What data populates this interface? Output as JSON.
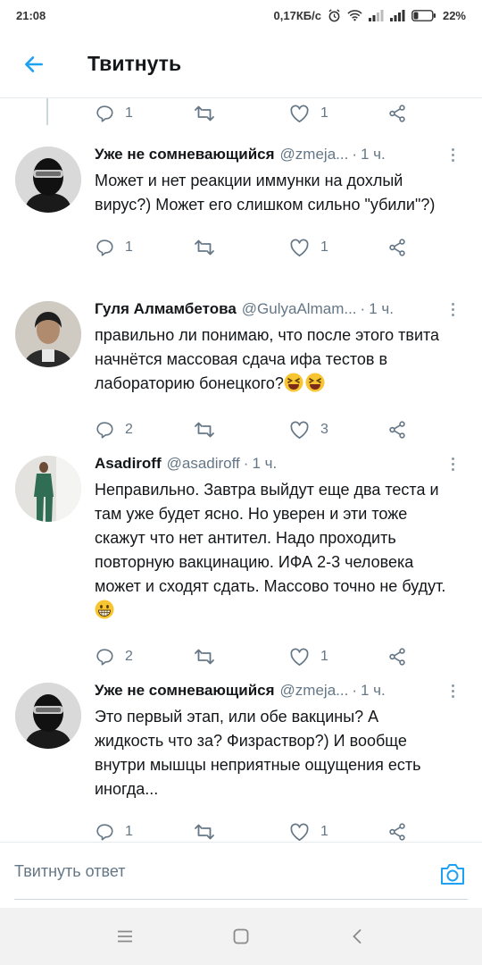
{
  "status_bar": {
    "time": "21:08",
    "network_speed": "0,17КБ/с",
    "battery": "22%",
    "icons": [
      "alarm-icon",
      "wifi-icon",
      "signal-icon",
      "signal-icon",
      "battery-icon"
    ]
  },
  "header": {
    "title": "Твитнуть",
    "back_icon": "arrow-left-icon"
  },
  "partial_tweet": {
    "replies": "1",
    "likes": "1"
  },
  "tweets": [
    {
      "name": "Уже не сомневающийся",
      "handle": "@zmeja...",
      "time": "1 ч.",
      "text": "Может и нет реакции иммунки на дохлый вирус?) Может его слишком сильно \"убили\"?)",
      "replies": "1",
      "likes": "1"
    },
    {
      "name": "Гуля Алмамбетова",
      "handle": "@GulyaAlmam...",
      "time": "1 ч.",
      "text": "правильно ли понимаю, что после этого твита начнётся массовая сдача ифа тестов в лабораторию бонецкого?",
      "emoji": "laughing-emoji",
      "replies": "2",
      "likes": "3"
    },
    {
      "name": "Asadiroff",
      "handle": "@asadiroff",
      "time": "1 ч.",
      "text": "Неправильно. Завтра выйдут еще два теста и там уже будет ясно. Но уверен и эти тоже скажут что нет антител. Надо проходить повторную вакцинацию. ИФА 2-3 человека может и сходят сдать. Массово точно не будут.",
      "emoji": "grinning-emoji",
      "replies": "2",
      "likes": "1"
    },
    {
      "name": "Уже не сомневающийся",
      "handle": "@zmeja...",
      "time": "1 ч.",
      "text": "Это первый этап, или обе вакцины? А жидкость что за? Физраствор?) И вообще внутри мышцы неприятные ощущения есть иногда...",
      "replies": "1",
      "likes": "1"
    }
  ],
  "reply_bar": {
    "placeholder": "Твитнуть ответ",
    "camera_icon": "camera-icon"
  },
  "colors": {
    "accent": "#1da1f2",
    "text": "#14171a",
    "secondary_text": "#657786",
    "divider": "#e6ecf0"
  }
}
